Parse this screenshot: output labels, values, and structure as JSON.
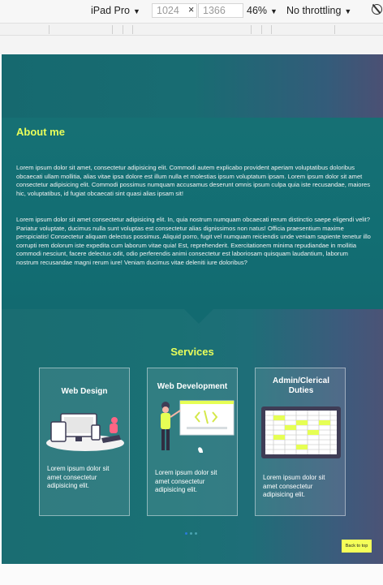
{
  "toolbar": {
    "device": "iPad Pro",
    "width": "1024",
    "times": "×",
    "height": "1366",
    "zoom": "46%",
    "throttling": "No throttling",
    "device_arrow": "▼",
    "zoom_arrow": "▼",
    "throttling_arrow": "▼"
  },
  "about": {
    "heading": "About me",
    "paragraph1": "Lorem ipsum dolor sit amet, consectetur adipisicing elit. Commodi autem explicabo provident aperiam voluptatibus doloribus obcaecati ullam mollitia, alias vitae ipsa dolore est illum nulla et molestias ipsum voluptatum ipsam. Lorem ipsum dolor sit amet consectetur adipisicing elit. Commodi possimus numquam accusamus deserunt omnis ipsum culpa quia iste recusandae, maiores hic, voluptatibus, id fugiat obcaecati sint quasi alias ipsam sit!",
    "paragraph2": "Lorem ipsum dolor sit amet consectetur adipisicing elit. In, quia nostrum numquam obcaecati rerum distinctio saepe eligendi velit? Pariatur voluptate, ducimus nulla sunt voluptas est consectetur alias dignissimos non natus! Officia praesentium maxime perspiciatis! Consectetur aliquam delectus possimus. Aliquid porro, fugit vel numquam reiciendis unde veniam sapiente tenetur illo corrupti rem dolorum iste expedita cum laborum vitae quia! Est, reprehenderit. Exercitationem minima repudiandae in mollitia commodi nesciunt, facere delectus odit, odio perferendis animi consectetur est laboriosam quisquam laudantium, laborum nostrum recusandae magni rerum iure! Veniam ducimus vitae deleniti iure doloribus?"
  },
  "services": {
    "heading": "Services",
    "cards": [
      {
        "title": "Web Design",
        "text": "Lorem ipsum dolor sit amet consectetur adipisicing elit."
      },
      {
        "title": "Web Development",
        "text": "Lorem ipsum dolor sit amet consectetur adipisicing elit."
      },
      {
        "title": "Admin/Clerical Duties",
        "text": "Lorem ipsum dolor sit amet consectetur adipisicing elit."
      }
    ]
  },
  "back_to_top": "Back to top",
  "icons": {
    "rotate": "rotate-icon",
    "web_design": "devices-illustration-icon",
    "web_development": "developer-illustration-icon",
    "admin": "spreadsheet-illustration-icon"
  },
  "colors": {
    "accent": "#e9ff5a",
    "page_teal": "#1a6d72",
    "page_purple": "#4b5376",
    "button_yellow": "#f4ff59"
  }
}
